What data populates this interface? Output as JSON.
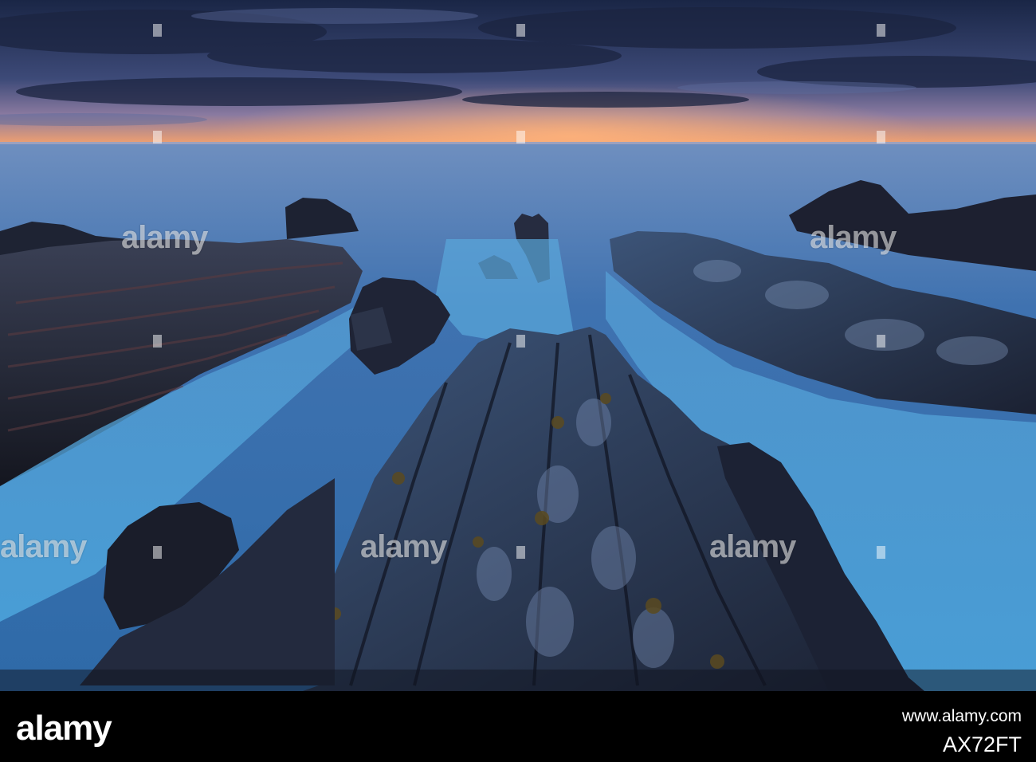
{
  "watermark": {
    "text": "alamy"
  },
  "footer": {
    "logo": "alamy",
    "url": "www.alamy.com",
    "image_id": "AX72FT"
  },
  "colors": {
    "sky_top": "#1c2a4d",
    "sunset_glow": "#f29a66",
    "sea_mist": "#4fa6d8",
    "rock_dark": "#1a1e2c",
    "footer_bg": "#000000"
  }
}
